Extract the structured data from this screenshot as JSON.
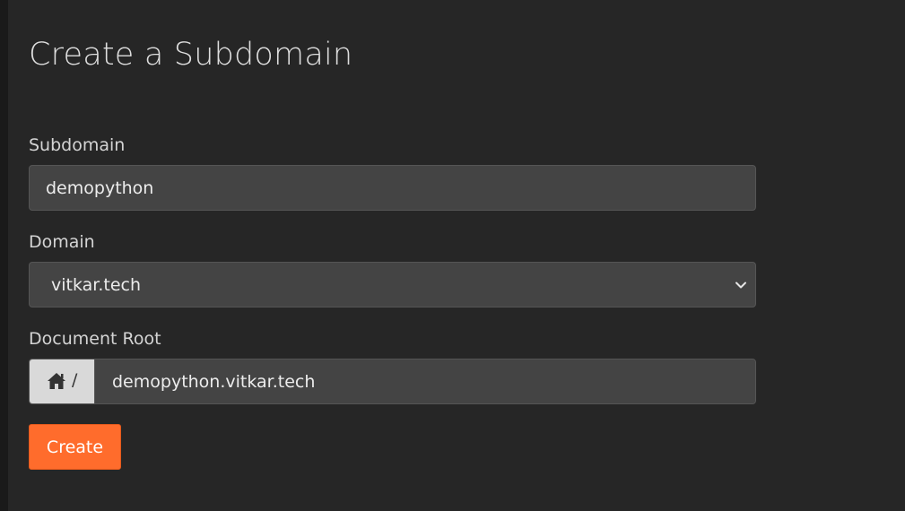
{
  "page": {
    "title": "Create a Subdomain"
  },
  "form": {
    "subdomain": {
      "label": "Subdomain",
      "value": "demopython"
    },
    "domain": {
      "label": "Domain",
      "selected": "vitkar.tech"
    },
    "document_root": {
      "label": "Document Root",
      "prefix_icon": "home-icon",
      "prefix_separator": "/",
      "value": "demopython.vitkar.tech"
    },
    "submit_label": "Create"
  },
  "colors": {
    "background": "#262626",
    "input_background": "#444444",
    "addon_background": "#d9d9d9",
    "accent": "#ff6c2c",
    "text": "#ececec"
  }
}
